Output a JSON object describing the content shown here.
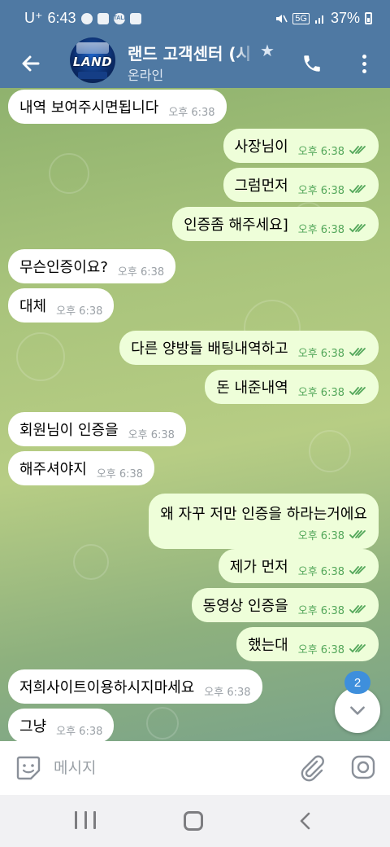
{
  "status_bar": {
    "carrier": "U⁺",
    "time": "6:43",
    "talk_label": "TALK",
    "network": "5G",
    "battery": "37%"
  },
  "header": {
    "title": "랜드 고객센터 (시",
    "subtitle": "온라인",
    "avatar_text": "LAND",
    "accent_color": "#4f79a3"
  },
  "messages": [
    {
      "dir": "in",
      "text": "내역 보여주시면됩니다",
      "time": "오후 6:38"
    },
    {
      "dir": "out",
      "text": "사장님이",
      "time": "오후 6:38"
    },
    {
      "dir": "out",
      "text": "그럼먼저",
      "time": "오후 6:38"
    },
    {
      "dir": "out",
      "text": "인증좀 해주세요]",
      "time": "오후 6:38"
    },
    {
      "dir": "in",
      "text": "무슨인증이요?",
      "time": "오후 6:38"
    },
    {
      "dir": "in",
      "text": "대체",
      "time": "오후 6:38"
    },
    {
      "dir": "out",
      "text": "다른 양방들 배팅내역하고",
      "time": "오후 6:38"
    },
    {
      "dir": "out",
      "text": "돈 내준내역",
      "time": "오후 6:38"
    },
    {
      "dir": "in",
      "text": "회원님이 인증을",
      "time": "오후 6:38"
    },
    {
      "dir": "in",
      "text": "해주셔야지",
      "time": "오후 6:38"
    },
    {
      "dir": "out",
      "text": "왜 자꾸 저만 인증을 하라는거에요",
      "time": "오후 6:38"
    },
    {
      "dir": "out",
      "text": "제가 먼저",
      "time": "오후 6:38"
    },
    {
      "dir": "out",
      "text": "동영상 인증을",
      "time": "오후 6:38"
    },
    {
      "dir": "out",
      "text": "했는대",
      "time": "오후 6:38"
    },
    {
      "dir": "in",
      "text": "저희사이트이용하시지마세요",
      "time": "오후 6:38"
    },
    {
      "dir": "in",
      "text": "그냥",
      "time": "오후 6:38"
    }
  ],
  "unread_count": "2",
  "composer": {
    "placeholder": "메시지"
  },
  "colors": {
    "outgoing_bubble": "#eefed9",
    "incoming_bubble": "#ffffff",
    "read_check": "#53a75a",
    "badge": "#3e8fdc"
  }
}
